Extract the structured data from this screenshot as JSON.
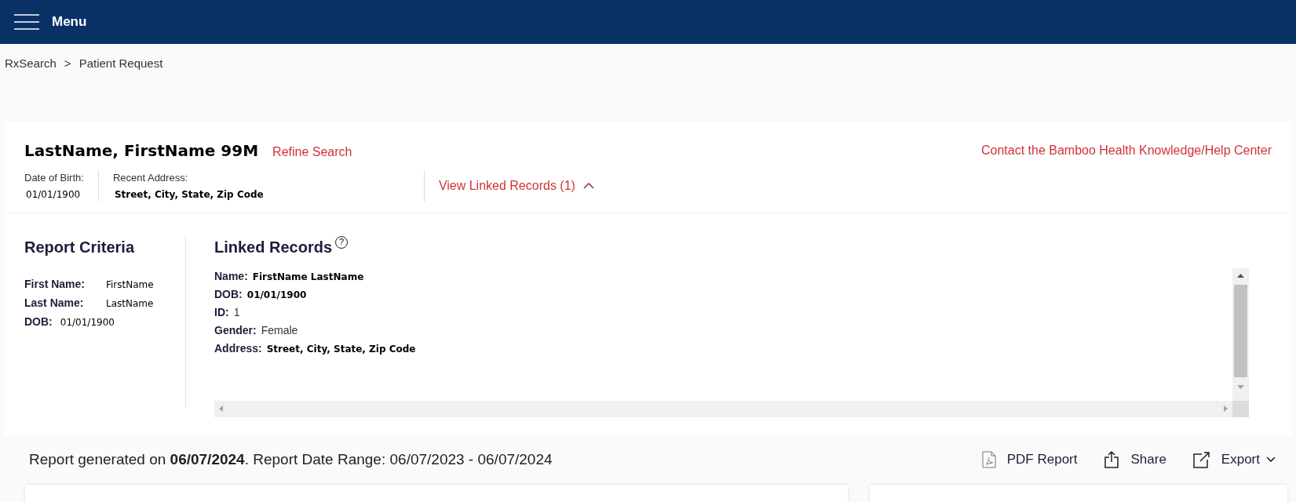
{
  "header": {
    "menu_label": "Menu"
  },
  "breadcrumb": [
    "RxSearch",
    "Patient Request"
  ],
  "breadcrumb_separator": ">",
  "patient": {
    "name": "LastName, FirstName 99M",
    "refine_link": "Refine Search",
    "help_link": "Contact the Bamboo Health Knowledge/Help Center",
    "fields": [
      {
        "label": "Date of Birth:",
        "value": "01/01/1900"
      },
      {
        "label": "Recent Address:",
        "value": "Street, City, State, Zip Code"
      }
    ],
    "linked_toggle": {
      "label": "View Linked Records (1)",
      "expanded": true
    }
  },
  "report_criteria": {
    "title": "Report Criteria",
    "fields": [
      {
        "label": "First Name:",
        "value": "FirstName"
      },
      {
        "label": "Last Name:",
        "value": "LastName"
      },
      {
        "label": "DOB:",
        "value": "01/01/1900"
      }
    ]
  },
  "linked_records": {
    "title": "Linked Records",
    "help_icon": "?",
    "fields": [
      {
        "label": "Name:",
        "value": "FirstName LastName",
        "kind": "mono"
      },
      {
        "label": "DOB:",
        "value": "01/01/1900",
        "kind": "mono"
      },
      {
        "label": "ID:",
        "value": "1",
        "kind": "plain"
      },
      {
        "label": "Gender:",
        "value": "Female",
        "kind": "plain"
      },
      {
        "label": "Address:",
        "value": "Street, City, State, Zip Code",
        "kind": "mono"
      }
    ]
  },
  "report_summary": "Report generated on **06/07/2024**. Report Date Range: 06/07/2023 - 06/07/2024",
  "actions": [
    {
      "kind": "pdf",
      "label": "PDF Report"
    },
    {
      "kind": "share",
      "label": "Share"
    },
    {
      "kind": "export",
      "label": "Export"
    }
  ]
}
